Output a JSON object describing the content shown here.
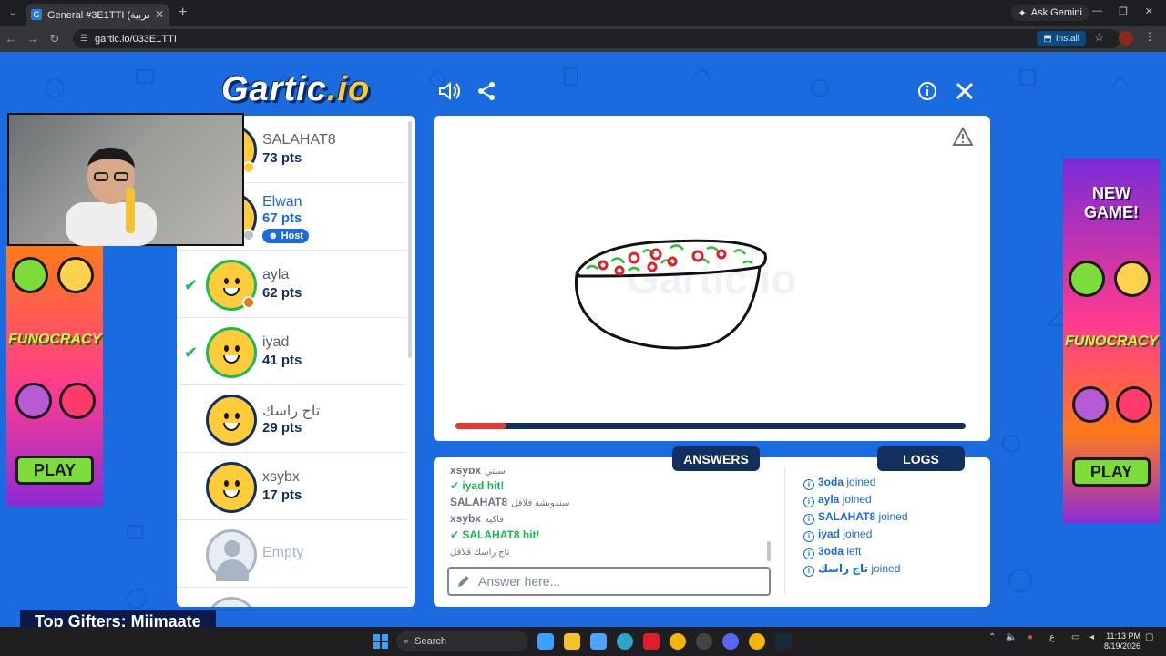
{
  "browser": {
    "tab_title": "General #3E1TTI (العربية) - Gartic",
    "url": "gartic.io/033E1TTI",
    "ask_gemini": "Ask Gemini",
    "install_label": "Install"
  },
  "game": {
    "logo_main": "Gartic",
    "logo_suffix": ".io",
    "players": [
      {
        "name": "SALAHAT8",
        "pts": "73 pts",
        "checked": false
      },
      {
        "name": "Elwan",
        "pts": "67 pts",
        "checked": false,
        "host": "Host"
      },
      {
        "name": "ayla",
        "pts": "62 pts",
        "checked": true
      },
      {
        "name": "iyad",
        "pts": "41 pts",
        "checked": true
      },
      {
        "name": "تاج راسك",
        "pts": "29 pts",
        "checked": false
      },
      {
        "name": "xsybx",
        "pts": "17 pts",
        "checked": false
      },
      {
        "name": "Empty",
        "pts": "",
        "checked": false
      }
    ],
    "round_progress": 0.1,
    "tabs": {
      "answers": "ANSWERS",
      "logs": "LOGS"
    },
    "answers": [
      {
        "user": "xsybx",
        "text": "سبتي"
      },
      {
        "user": "iyad",
        "text": "hit!",
        "hit": true
      },
      {
        "user": "SALAHAT8",
        "text": "سندويشة فلافل"
      },
      {
        "user": "xsybx",
        "text": "فاكية"
      },
      {
        "user": "SALAHAT8",
        "text": "hit!",
        "hit": true
      },
      {
        "user": "",
        "text": "تاج راسك فلافل"
      }
    ],
    "answer_placeholder": "Answer here...",
    "logs": [
      {
        "user": "3oda",
        "action": "joined"
      },
      {
        "user": "ayla",
        "action": "joined"
      },
      {
        "user": "SALAHAT8",
        "action": "joined"
      },
      {
        "user": "iyad",
        "action": "joined"
      },
      {
        "user": "3oda",
        "action": "left"
      },
      {
        "user": "تاج راسك",
        "action": "joined"
      }
    ]
  },
  "ads": {
    "new_game": "NEW GAME!",
    "brand": "FUNOCRACY",
    "play": "PLAY"
  },
  "overlay": {
    "top_gifters": "Top Gifters: Miimaate"
  },
  "taskbar": {
    "search": "Search",
    "time": "11:13 PM",
    "date": "8/19/2026",
    "lang": "ع"
  },
  "colors": {
    "page_bg": "#1a6be0",
    "navy": "#12305f",
    "hit_green": "#1db954",
    "progress_red": "#e53935"
  }
}
